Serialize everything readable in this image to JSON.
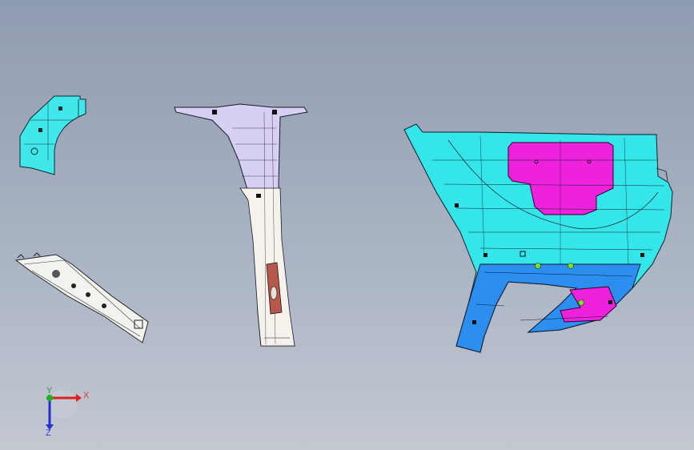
{
  "triad": {
    "x_label": "X",
    "y_label": "Y",
    "z_label": "Z",
    "colors": {
      "x": "#e02020",
      "y": "#20b020",
      "z": "#2030d0"
    }
  },
  "parts": [
    {
      "name": "upper-left-bracket",
      "color": "#40e8ec"
    },
    {
      "name": "lower-left-trim-strip",
      "color": "#f2f2ee"
    },
    {
      "name": "pillar-trim",
      "color": "#d8d0f2"
    },
    {
      "name": "quarter-trim-panel",
      "color": "#34e6ea"
    }
  ],
  "accent_colors": {
    "magenta": "#ee22dd",
    "panel_blue": "#2c8ff0",
    "rust": "#b4594c",
    "green_pin": "#7ee02a"
  }
}
